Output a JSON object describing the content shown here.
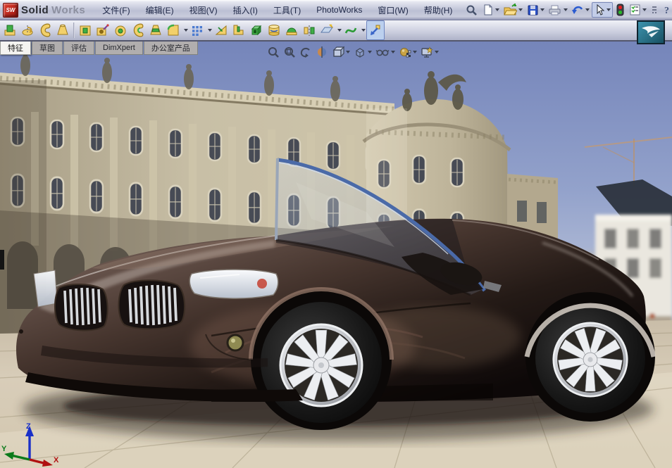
{
  "window": {
    "logo_badge": "SW",
    "logo_bold": "Solid",
    "logo_light": "Works"
  },
  "menubar": {
    "items": [
      {
        "label": "文件(F)"
      },
      {
        "label": "编辑(E)"
      },
      {
        "label": "视图(V)"
      },
      {
        "label": "插入(I)"
      },
      {
        "label": "工具(T)"
      },
      {
        "label": "PhotoWorks"
      },
      {
        "label": "窗口(W)"
      },
      {
        "label": "帮助(H)"
      }
    ]
  },
  "standard_toolbar": {
    "icons": [
      "search",
      "new-document",
      "open",
      "save",
      "print",
      "undo",
      "select-cursor",
      "rebuild-traffic-light",
      "options",
      "toolbar-overflow",
      "help"
    ]
  },
  "features_toolbar": {
    "icons": [
      "extruded-boss",
      "revolved-boss",
      "swept-boss",
      "lofted-boss",
      "extruded-cut",
      "hole-wizard",
      "revolved-cut",
      "swept-cut",
      "lofted-cut",
      "fillet",
      "linear-pattern",
      "draft",
      "rib",
      "shell",
      "wrap",
      "dome",
      "mirror",
      "reference-geometry",
      "curves",
      "instant3d"
    ]
  },
  "command_tabs": {
    "tabs": [
      {
        "label": "特征",
        "active": true
      },
      {
        "label": "草图",
        "active": false
      },
      {
        "label": "评估",
        "active": false
      },
      {
        "label": "DimXpert",
        "active": false
      },
      {
        "label": "办公室产品",
        "active": false
      }
    ]
  },
  "heads_up_toolbar": {
    "icons": [
      "zoom-to-fit",
      "zoom-to-area",
      "previous-view",
      "section-view",
      "view-orientation",
      "display-style",
      "hide-show-items",
      "apply-scene",
      "view-settings"
    ]
  },
  "triad": {
    "x": "X",
    "y": "Y",
    "z": "Z",
    "x_color": "#b01010",
    "y_color": "#0a7a1a",
    "z_color": "#1a30c8"
  },
  "viewport": {
    "content": "photoworks-rendering-dark-bronze-roadster-before-baroque-building"
  },
  "colors": {
    "car_paint": "#3a2c28",
    "sky_top": "#7b8cbe",
    "building_stone": "#c3b99f",
    "ground": "#d6cbb7",
    "windshield_frame": "#4a6aa8",
    "task_pane_teal": "#2e86a0",
    "rim_chrome": "#d9dadd",
    "grille_chrome": "#d6d9dd"
  }
}
